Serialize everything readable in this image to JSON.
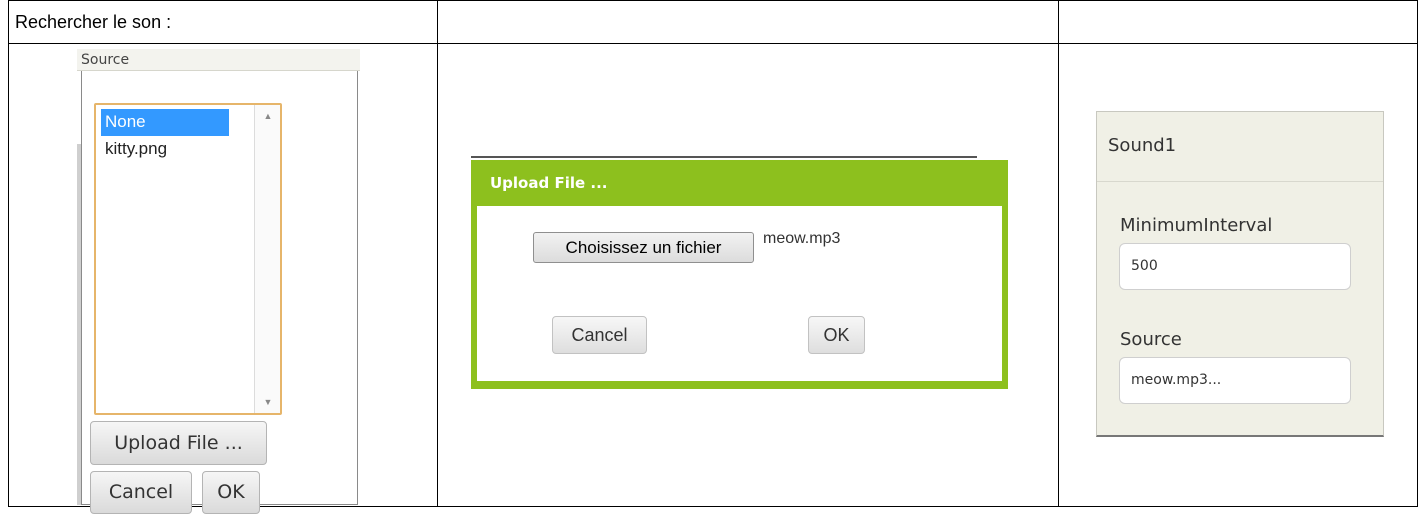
{
  "document": {
    "header_text": "Rechercher le son :"
  },
  "source_picker": {
    "title": "Source",
    "options": [
      "None",
      "kitty.png"
    ],
    "selected": "None",
    "upload_label": "Upload File ...",
    "cancel_label": "Cancel",
    "ok_label": "OK"
  },
  "upload_dialog": {
    "title": "Upload File ...",
    "choose_label": "Choisissez un fichier",
    "file_name": "meow.mp3",
    "cancel_label": "Cancel",
    "ok_label": "OK",
    "accent_color": "#8dc01e"
  },
  "properties": {
    "component": "Sound1",
    "minimum_interval_label": "MinimumInterval",
    "minimum_interval_value": "500",
    "source_label": "Source",
    "source_value": "meow.mp3..."
  },
  "icons": {
    "scroll_up": "scroll-up-arrow-icon",
    "scroll_down": "scroll-down-arrow-icon"
  }
}
